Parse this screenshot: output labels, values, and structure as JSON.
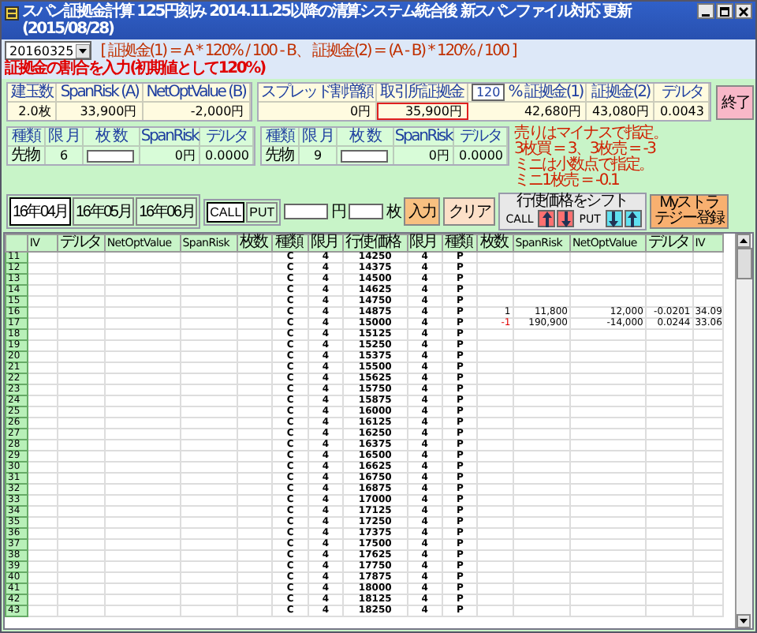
{
  "window": {
    "title": "スパン証拠金計算 125円刻み 2014.11.25以降の清算システム統合後 新スパンファイル対応 更新(2015/08/28)"
  },
  "month_select": {
    "value": "20160325"
  },
  "formula_note": "[ 証拠金(1) = A * 120% / 100 - B、 証拠金(2) = (A - B) * 120% / 100 ]",
  "ratio_note": "証拠金の割合を入力(初期値として120%)",
  "summary_groups": [
    {
      "items": [
        {
          "kind": "plain",
          "label": "建玉数",
          "value": "2.0枚",
          "highlighted": false
        },
        {
          "kind": "plain",
          "label": "SpanRisk (A)",
          "value": "33,900円",
          "highlighted": false
        },
        {
          "kind": "plain",
          "label": "NetOptValue (B)",
          "value": "-2,000円",
          "highlighted": false
        }
      ]
    },
    {
      "items": [
        {
          "kind": "plain",
          "label": "スプレッド割増額",
          "value": "0円",
          "highlighted": false
        },
        {
          "kind": "plain",
          "label": "取引所証拠金",
          "value": "35,900円",
          "highlighted": true
        },
        {
          "kind": "ratio",
          "ratio": "120",
          "label": "% 証拠金(1)",
          "value": "42,680円",
          "highlighted": false
        },
        {
          "kind": "plain",
          "label": "証拠金(2)",
          "value": "43,080円",
          "highlighted": false
        },
        {
          "kind": "plain",
          "label": "デルタ",
          "value": "0.0043",
          "highlighted": false
        }
      ]
    }
  ],
  "exit_button": "終了",
  "futures_panels": [
    {
      "headers": [
        "種類",
        "限 月",
        "枚 数",
        "SpanRisk",
        "デルタ"
      ],
      "type": "先物",
      "month": "6",
      "span_risk": "0円",
      "delta": "0.0000"
    },
    {
      "headers": [
        "種類",
        "限 月",
        "枚 数",
        "SpanRisk",
        "デルタ"
      ],
      "type": "先物",
      "month": "9",
      "span_risk": "0円",
      "delta": "0.0000"
    }
  ],
  "input_note": [
    "売りはマイナスで指定。",
    "3枚買 = 3、3枚売 = -3",
    "ミニは小数点で指定。",
    "ミニ1枚売 = -0.1"
  ],
  "month_buttons": [
    {
      "label": "16年04月",
      "selected": true
    },
    {
      "label": "16年05月",
      "selected": false
    },
    {
      "label": "16年06月",
      "selected": false
    }
  ],
  "option_buttons": [
    {
      "label": "CALL",
      "selected": true
    },
    {
      "label": "PUT",
      "selected": false
    }
  ],
  "price_unit": "円",
  "qty_unit": "枚",
  "input_button": "入力",
  "clear_button": "クリア",
  "shift": {
    "title": "行使価格をシフト",
    "groups": [
      {
        "label": "CALL",
        "color": "#ff7070",
        "arrows": [
          {
            "kind": "up"
          },
          {
            "kind": "down"
          }
        ]
      },
      {
        "label": "PUT",
        "color": "#60e0f0",
        "arrows": [
          {
            "kind": "down"
          },
          {
            "kind": "up"
          }
        ]
      }
    ]
  },
  "strategy_button": "Myストラテジー登録",
  "table": {
    "columns": [
      "IV",
      "デルタ",
      "NetOptValue",
      "SpanRisk",
      "枚数",
      "種類",
      "限月",
      "行使価格",
      "限月",
      "種類",
      "枚数",
      "SpanRisk",
      "NetOptValue",
      "デルタ",
      "IV"
    ],
    "rows": [
      {
        "no": "11",
        "call_type": "C",
        "call_month": "4",
        "strike": "14250",
        "put_month": "4",
        "put_type": "P"
      },
      {
        "no": "12",
        "call_type": "C",
        "call_month": "4",
        "strike": "14375",
        "put_month": "4",
        "put_type": "P"
      },
      {
        "no": "13",
        "call_type": "C",
        "call_month": "4",
        "strike": "14500",
        "put_month": "4",
        "put_type": "P"
      },
      {
        "no": "14",
        "call_type": "C",
        "call_month": "4",
        "strike": "14625",
        "put_month": "4",
        "put_type": "P"
      },
      {
        "no": "15",
        "call_type": "C",
        "call_month": "4",
        "strike": "14750",
        "put_month": "4",
        "put_type": "P"
      },
      {
        "no": "16",
        "call_type": "C",
        "call_month": "4",
        "strike": "14875",
        "put_month": "4",
        "put_type": "P",
        "put_position": {
          "qty": "1",
          "short": false,
          "span_risk": "11,800",
          "net_opt_value": "12,000",
          "delta": "-0.0201",
          "iv": "34.09"
        }
      },
      {
        "no": "17",
        "call_type": "C",
        "call_month": "4",
        "strike": "15000",
        "put_month": "4",
        "put_type": "P",
        "put_position": {
          "qty": "-1",
          "short": true,
          "span_risk": "190,900",
          "net_opt_value": "-14,000",
          "delta": "0.0244",
          "iv": "33.06"
        }
      },
      {
        "no": "18",
        "call_type": "C",
        "call_month": "4",
        "strike": "15125",
        "put_month": "4",
        "put_type": "P"
      },
      {
        "no": "19",
        "call_type": "C",
        "call_month": "4",
        "strike": "15250",
        "put_month": "4",
        "put_type": "P"
      },
      {
        "no": "20",
        "call_type": "C",
        "call_month": "4",
        "strike": "15375",
        "put_month": "4",
        "put_type": "P"
      },
      {
        "no": "21",
        "call_type": "C",
        "call_month": "4",
        "strike": "15500",
        "put_month": "4",
        "put_type": "P"
      },
      {
        "no": "22",
        "call_type": "C",
        "call_month": "4",
        "strike": "15625",
        "put_month": "4",
        "put_type": "P"
      },
      {
        "no": "23",
        "call_type": "C",
        "call_month": "4",
        "strike": "15750",
        "put_month": "4",
        "put_type": "P"
      },
      {
        "no": "24",
        "call_type": "C",
        "call_month": "4",
        "strike": "15875",
        "put_month": "4",
        "put_type": "P"
      },
      {
        "no": "25",
        "call_type": "C",
        "call_month": "4",
        "strike": "16000",
        "put_month": "4",
        "put_type": "P"
      },
      {
        "no": "26",
        "call_type": "C",
        "call_month": "4",
        "strike": "16125",
        "put_month": "4",
        "put_type": "P"
      },
      {
        "no": "27",
        "call_type": "C",
        "call_month": "4",
        "strike": "16250",
        "put_month": "4",
        "put_type": "P"
      },
      {
        "no": "28",
        "call_type": "C",
        "call_month": "4",
        "strike": "16375",
        "put_month": "4",
        "put_type": "P"
      },
      {
        "no": "29",
        "call_type": "C",
        "call_month": "4",
        "strike": "16500",
        "put_month": "4",
        "put_type": "P"
      },
      {
        "no": "30",
        "call_type": "C",
        "call_month": "4",
        "strike": "16625",
        "put_month": "4",
        "put_type": "P"
      },
      {
        "no": "31",
        "call_type": "C",
        "call_month": "4",
        "strike": "16750",
        "put_month": "4",
        "put_type": "P"
      },
      {
        "no": "32",
        "call_type": "C",
        "call_month": "4",
        "strike": "16875",
        "put_month": "4",
        "put_type": "P"
      },
      {
        "no": "33",
        "call_type": "C",
        "call_month": "4",
        "strike": "17000",
        "put_month": "4",
        "put_type": "P"
      },
      {
        "no": "34",
        "call_type": "C",
        "call_month": "4",
        "strike": "17125",
        "put_month": "4",
        "put_type": "P"
      },
      {
        "no": "35",
        "call_type": "C",
        "call_month": "4",
        "strike": "17250",
        "put_month": "4",
        "put_type": "P"
      },
      {
        "no": "36",
        "call_type": "C",
        "call_month": "4",
        "strike": "17375",
        "put_month": "4",
        "put_type": "P"
      },
      {
        "no": "37",
        "call_type": "C",
        "call_month": "4",
        "strike": "17500",
        "put_month": "4",
        "put_type": "P"
      },
      {
        "no": "38",
        "call_type": "C",
        "call_month": "4",
        "strike": "17625",
        "put_month": "4",
        "put_type": "P"
      },
      {
        "no": "39",
        "call_type": "C",
        "call_month": "4",
        "strike": "17750",
        "put_month": "4",
        "put_type": "P"
      },
      {
        "no": "40",
        "call_type": "C",
        "call_month": "4",
        "strike": "17875",
        "put_month": "4",
        "put_type": "P"
      },
      {
        "no": "41",
        "call_type": "C",
        "call_month": "4",
        "strike": "18000",
        "put_month": "4",
        "put_type": "P"
      },
      {
        "no": "42",
        "call_type": "C",
        "call_month": "4",
        "strike": "18125",
        "put_month": "4",
        "put_type": "P"
      },
      {
        "no": "43",
        "call_type": "C",
        "call_month": "4",
        "strike": "18250",
        "put_month": "4",
        "put_type": "P"
      }
    ]
  }
}
